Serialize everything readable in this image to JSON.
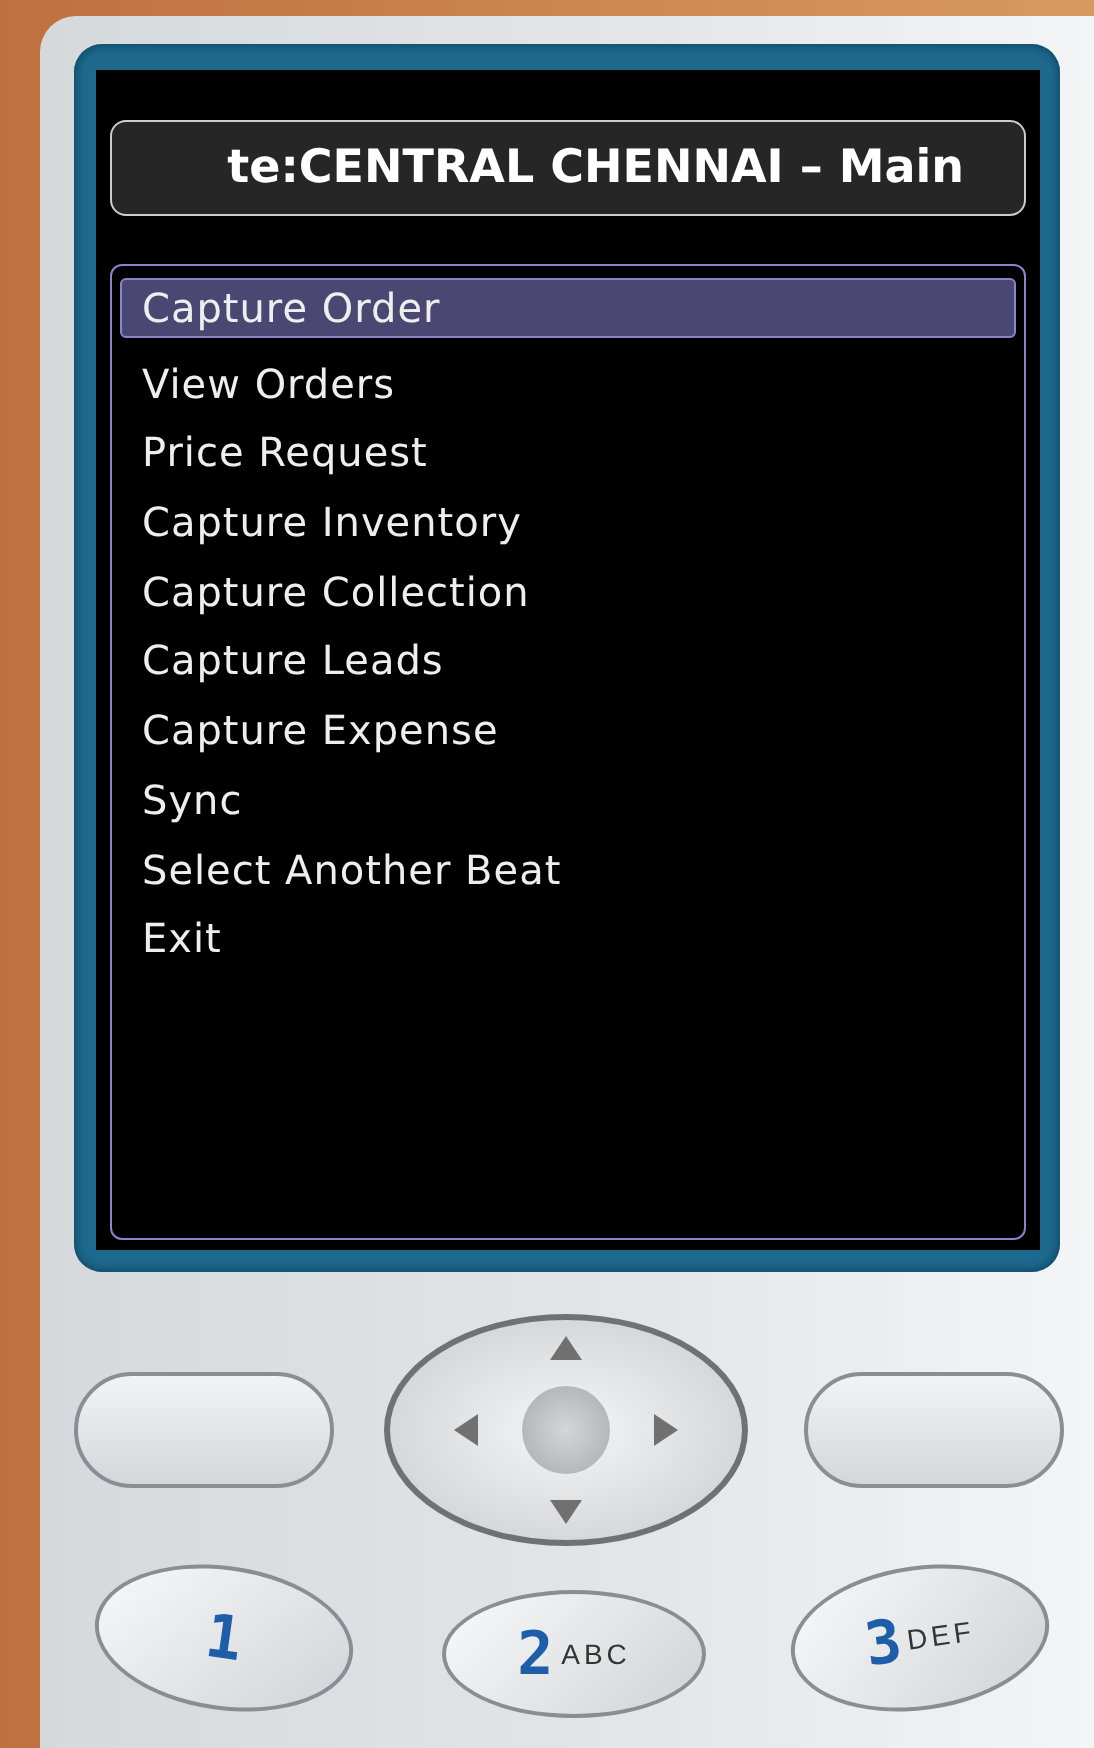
{
  "title": "te:CENTRAL CHENNAI – Main",
  "menu": [
    {
      "label": "Capture Order",
      "selected": true
    },
    {
      "label": "View Orders",
      "selected": false
    },
    {
      "label": "Price Request",
      "selected": false
    },
    {
      "label": "Capture Inventory",
      "selected": false
    },
    {
      "label": "Capture Collection",
      "selected": false
    },
    {
      "label": "Capture Leads",
      "selected": false
    },
    {
      "label": "Capture Expense",
      "selected": false
    },
    {
      "label": "Sync",
      "selected": false
    },
    {
      "label": "Select Another Beat",
      "selected": false
    },
    {
      "label": "Exit",
      "selected": false
    }
  ],
  "keys": [
    {
      "digit": "1"
    },
    {
      "digit": "2",
      "letters": "ABC"
    },
    {
      "digit": "3",
      "letters": "DEF"
    }
  ]
}
